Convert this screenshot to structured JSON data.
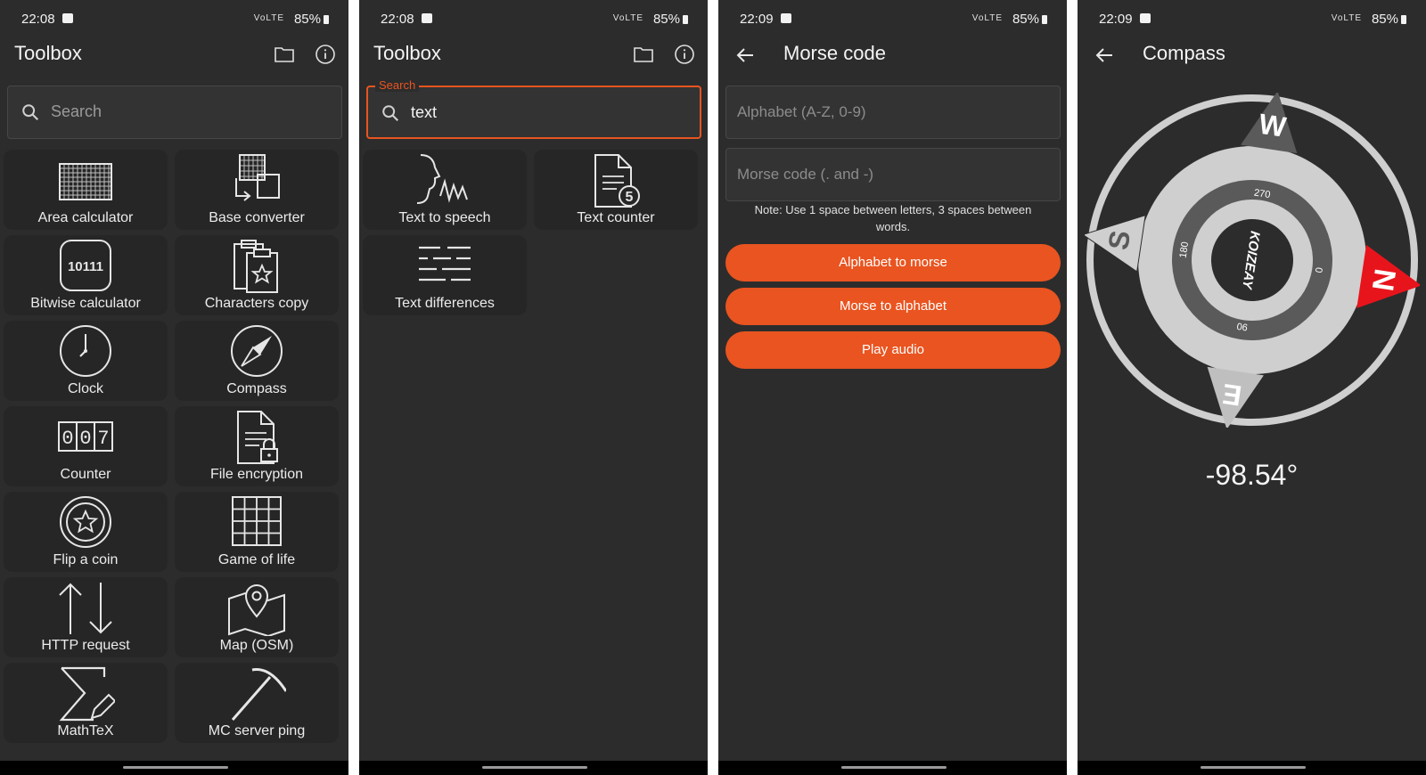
{
  "screens": [
    {
      "status": {
        "time": "22:08",
        "signal": "VoLTE",
        "battery": "85%"
      },
      "appbar_title": "Toolbox",
      "search": {
        "placeholder": "Search"
      },
      "tools": [
        "Area calculator",
        "Base converter",
        "Bitwise calculator",
        "Characters copy",
        "Clock",
        "Compass",
        "Counter",
        "File encryption",
        "Flip a coin",
        "Game of life",
        "HTTP request",
        "Map (OSM)",
        "MathTeX",
        "MC server ping"
      ],
      "icon_texts": {
        "bitwise": "10111",
        "counter": [
          "0",
          "0",
          "7"
        ]
      }
    },
    {
      "status": {
        "time": "22:08",
        "signal": "VoLTE",
        "battery": "85%"
      },
      "appbar_title": "Toolbox",
      "search": {
        "label": "Search",
        "value": "text"
      },
      "tools": [
        "Text to speech",
        "Text counter",
        "Text differences"
      ],
      "icon_texts": {
        "counter_badge": "5"
      }
    },
    {
      "status": {
        "time": "22:09",
        "signal": "VoLTE",
        "battery": "85%"
      },
      "appbar_title": "Morse code",
      "alphabet_placeholder": "Alphabet (A-Z, 0-9)",
      "morse_placeholder": "Morse code (. and -)",
      "note": "Note: Use 1 space between letters, 3 spaces between words.",
      "buttons": [
        "Alphabet to morse",
        "Morse to alphabet",
        "Play audio"
      ]
    },
    {
      "status": {
        "time": "22:09",
        "signal": "VoLTE",
        "battery": "85%"
      },
      "appbar_title": "Compass",
      "compass": {
        "cardinals": [
          "N",
          "E",
          "S",
          "W"
        ],
        "degree_marks": [
          "0",
          "90",
          "180",
          "270"
        ],
        "brand": "KOIZEAY",
        "rotation_deg": -98.54
      },
      "heading": "-98.54°"
    }
  ],
  "colors": {
    "accent": "#e95420",
    "background": "#2c2c2c",
    "tile": "#262626",
    "needle": "#e8141c"
  }
}
